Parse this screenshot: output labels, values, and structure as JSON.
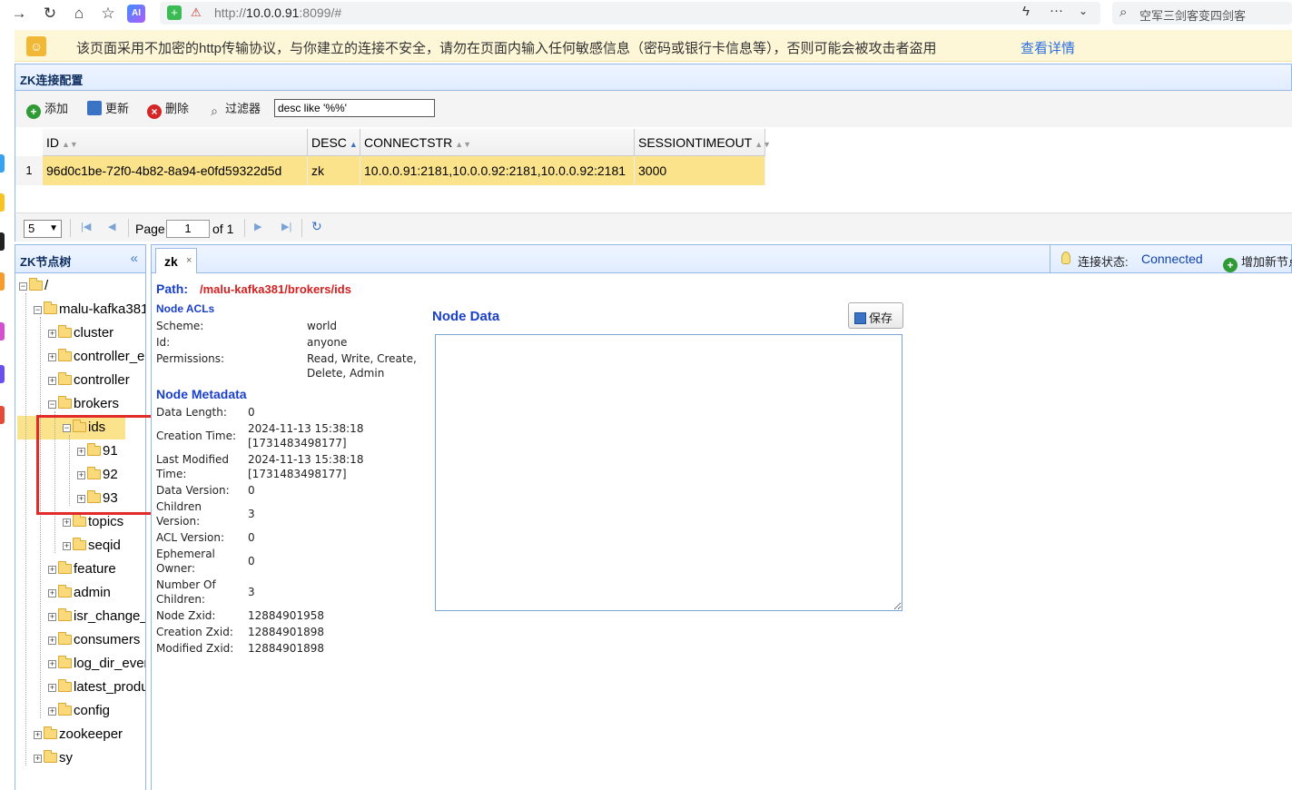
{
  "browser": {
    "url_prefix": "http://",
    "url_host": "10.0.0.91",
    "url_suffix": ":8099/#",
    "search_placeholder": "空军三剑客变四剑客",
    "ai_badge": "AI"
  },
  "warning": {
    "text": "该页面采用不加密的http传输协议，与你建立的连接不安全，请勿在页面内输入任何敏感信息（密码或银行卡信息等），否则可能会被攻击者盗用",
    "link": "查看详情"
  },
  "config_panel": {
    "title": "ZK连接配置",
    "toolbar": {
      "add": "添加",
      "update": "更新",
      "delete": "删除",
      "filter": "过滤器",
      "filter_value": "desc like '%%'"
    },
    "grid": {
      "columns": [
        "ID",
        "DESC",
        "CONNECTSTR",
        "SESSIONTIMEOUT"
      ],
      "rows": [
        {
          "num": "1",
          "id": "96d0c1be-72f0-4b82-8a94-e0fd59322d5d",
          "desc": "zk",
          "connectstr": "10.0.0.91:2181,10.0.0.92:2181,10.0.0.92:2181",
          "sessiontimeout": "3000"
        }
      ]
    },
    "pager": {
      "page_size": "5",
      "page_label": "Page",
      "page_value": "1",
      "of_label": "of 1"
    }
  },
  "tree": {
    "title": "ZK节点树",
    "nodes": [
      {
        "label": "/"
      },
      {
        "label": "malu-kafka381"
      },
      {
        "label": "cluster"
      },
      {
        "label": "controller_epoch"
      },
      {
        "label": "controller"
      },
      {
        "label": "brokers"
      },
      {
        "label": "ids"
      },
      {
        "label": "91"
      },
      {
        "label": "92"
      },
      {
        "label": "93"
      },
      {
        "label": "topics"
      },
      {
        "label": "seqid"
      },
      {
        "label": "feature"
      },
      {
        "label": "admin"
      },
      {
        "label": "isr_change_notification"
      },
      {
        "label": "consumers"
      },
      {
        "label": "log_dir_event_notification"
      },
      {
        "label": "latest_producer_id_block"
      },
      {
        "label": "config"
      },
      {
        "label": "zookeeper"
      },
      {
        "label": "sy"
      }
    ]
  },
  "tabs": {
    "active": "zk",
    "close": "×",
    "conn_label": "连接状态:",
    "conn_status": "Connected",
    "add_node": "增加新节点"
  },
  "node": {
    "path_label": "Path:",
    "path_value": "/malu-kafka381/brokers/ids",
    "acls_title": "Node ACLs",
    "acls": {
      "scheme_label": "Scheme:",
      "scheme": "world",
      "id_label": "Id:",
      "id": "anyone",
      "perm_label": "Permissions:",
      "perm_line1": "Read, Write, Create,",
      "perm_line2": "Delete, Admin"
    },
    "meta_title": "Node Metadata",
    "meta": {
      "data_length_label": "Data Length:",
      "data_length": "0",
      "ctime_label": "Creation Time:",
      "ctime1": "2024-11-13 15:38:18",
      "ctime2": "[1731483498177]",
      "mtime_label1": "Last Modified",
      "mtime_label2": "Time:",
      "mtime1": "2024-11-13 15:38:18",
      "mtime2": "[1731483498177]",
      "data_version_label": "Data Version:",
      "data_version": "0",
      "children_version_label1": "Children",
      "children_version_label2": "Version:",
      "children_version": "3",
      "acl_version_label": "ACL Version:",
      "acl_version": "0",
      "ephemeral_label1": "Ephemeral",
      "ephemeral_label2": "Owner:",
      "ephemeral": "0",
      "num_children_label1": "Number Of",
      "num_children_label2": "Children:",
      "num_children": "3",
      "zxid_label": "Node Zxid:",
      "zxid": "12884901958",
      "czxid_label": "Creation Zxid:",
      "czxid": "12884901898",
      "mzxid_label": "Modified Zxid:",
      "mzxid": "12884901898"
    },
    "data_title": "Node Data",
    "save": "保存",
    "data_value": ""
  }
}
